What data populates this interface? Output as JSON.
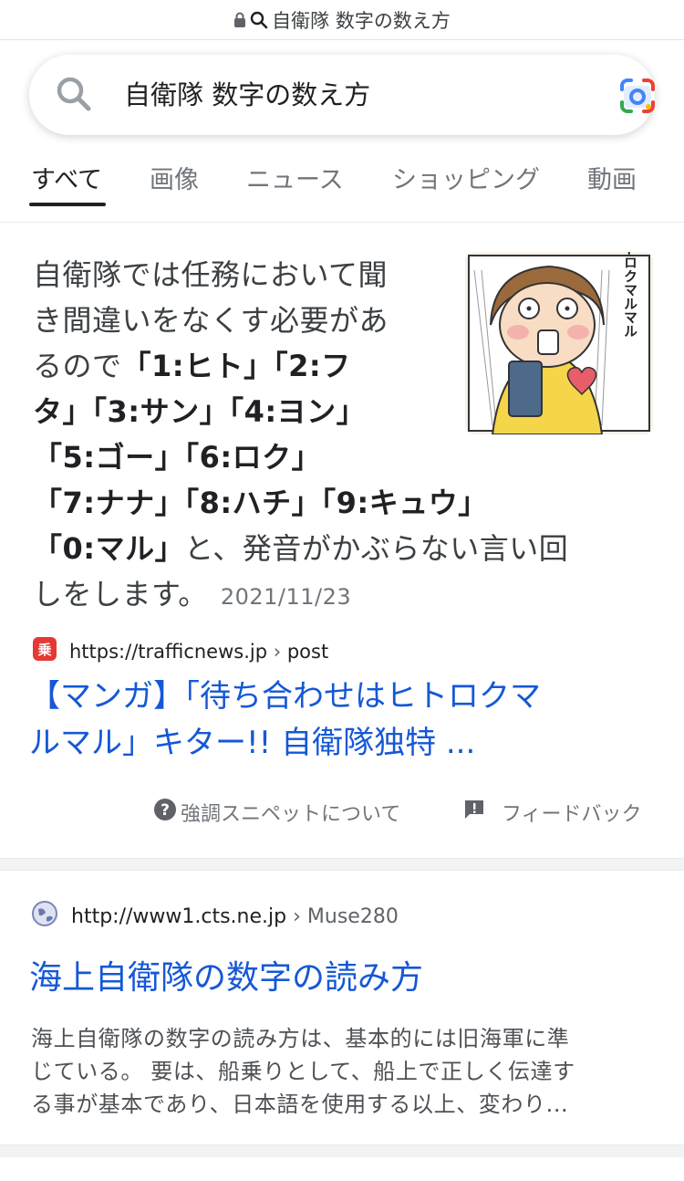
{
  "url_bar": {
    "text": "自衛隊 数字の数え方",
    "icons": [
      "lock-icon",
      "search-icon"
    ]
  },
  "search": {
    "query": "自衛隊 数字の数え方",
    "icons": [
      "search-icon",
      "google-lens-icon"
    ]
  },
  "tabs": [
    {
      "label": "すべて",
      "active": true
    },
    {
      "label": "画像",
      "active": false
    },
    {
      "label": "ニュース",
      "active": false
    },
    {
      "label": "ショッピング",
      "active": false
    },
    {
      "label": "動画",
      "active": false
    }
  ],
  "featured_snippet": {
    "lines": [
      [
        {
          "t": "自衛隊では任務において聞",
          "b": false
        }
      ],
      [
        {
          "t": "き間違いをなくす必要があ",
          "b": false
        }
      ],
      [
        {
          "t": "るので",
          "b": false
        },
        {
          "t": "「1:ヒト」「2:フ",
          "b": true
        }
      ],
      [
        {
          "t": "タ」「3:サン」「4:ヨン」",
          "b": true
        }
      ],
      [
        {
          "t": "「5:ゴー」「6:ロク」",
          "b": true
        }
      ],
      [
        {
          "t": "「7:ナナ」「8:ハチ」「9:キュウ」",
          "b": true
        }
      ],
      [
        {
          "t": "「0:マル」",
          "b": true
        },
        {
          "t": "と、発音がかぶらない言い回",
          "b": false
        }
      ],
      [
        {
          "t": "しをします。",
          "b": false
        }
      ]
    ],
    "date": "2021/11/23",
    "thumbnail_text": "ヒトロクマルマル",
    "source_url": "https://trafficnews.jp",
    "source_path": "post",
    "source_favicon": "乗",
    "title_line1": "【マンガ】「待ち合わせはヒトロクマ",
    "title_line2": "ルマル」キター!! 自衛隊独特 ...",
    "about_label": "強調スニペットについて",
    "feedback_label": "フィードバック"
  },
  "result2": {
    "url": "http://www1.cts.ne.jp",
    "path": "Muse280",
    "title": "海上自衛隊の数字の読み方",
    "desc_line1": "海上自衛隊の数字の読み方は、基本的には旧海軍に準",
    "desc_line2": "じている。 要は、船乗りとして、船上で正しく伝達す",
    "desc_line3": "る事が基本であり、日本語を使用する以上、変わり..."
  },
  "colors": {
    "link": "#1558d6",
    "text": "#202124",
    "muted": "#70757a",
    "favicon_red": "#e53935"
  }
}
